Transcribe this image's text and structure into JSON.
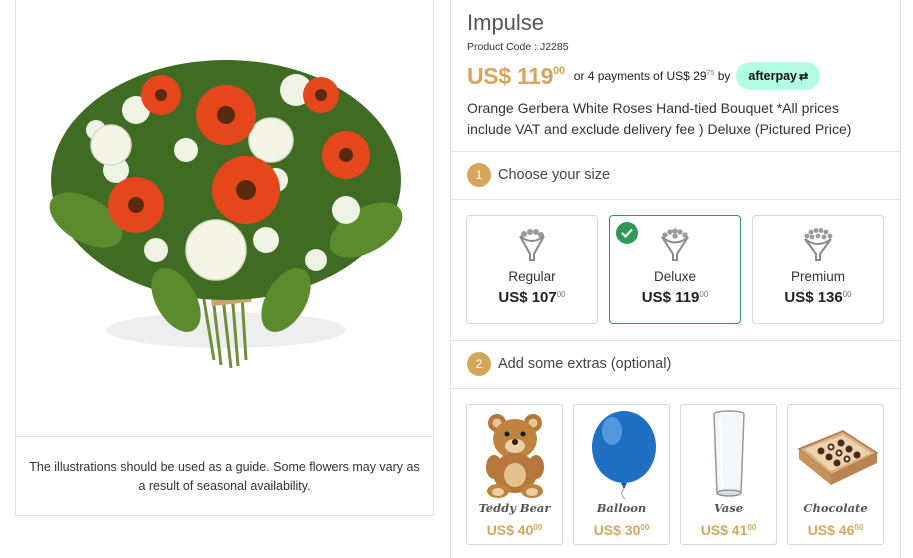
{
  "product": {
    "title": "Impulse",
    "code": "Product Code : J2285",
    "currency": "US$",
    "price_main": "119",
    "price_cents": "00",
    "installments_text": "or 4 payments of US$ 29",
    "installments_cents": "75",
    "installments_by": "by",
    "afterpay_label": "afterpay",
    "afterpay_mark": "⇄",
    "description": "Orange Gerbera White Roses Hand-tied Bouquet *All prices include VAT and exclude delivery fee ) Deluxe (Pictured Price)",
    "image_caption": "The illustrations should be used as a guide. Some flowers may vary as a result of seasonal availability."
  },
  "colors": {
    "accent": "#d6a65c",
    "selected": "#2f9a58",
    "afterpay": "#b2fce4"
  },
  "steps": [
    {
      "num": "1",
      "label": "Choose your size"
    },
    {
      "num": "2",
      "label": "Add some extras (optional)"
    }
  ],
  "sizes": [
    {
      "label": "Regular",
      "price": "US$ 107",
      "cents": "00",
      "selected": false,
      "icon": "bouquet-small-icon"
    },
    {
      "label": "Deluxe",
      "price": "US$ 119",
      "cents": "00",
      "selected": true,
      "icon": "bouquet-medium-icon"
    },
    {
      "label": "Premium",
      "price": "US$ 136",
      "cents": "00",
      "selected": false,
      "icon": "bouquet-large-icon"
    }
  ],
  "extras": [
    {
      "name": "Teddy Bear",
      "price": "US$ 40",
      "cents": "00"
    },
    {
      "name": "Balloon",
      "price": "US$ 30",
      "cents": "00"
    },
    {
      "name": "Vase",
      "price": "US$ 41",
      "cents": "00"
    },
    {
      "name": "Chocolate",
      "price": "US$ 46",
      "cents": "00"
    }
  ]
}
